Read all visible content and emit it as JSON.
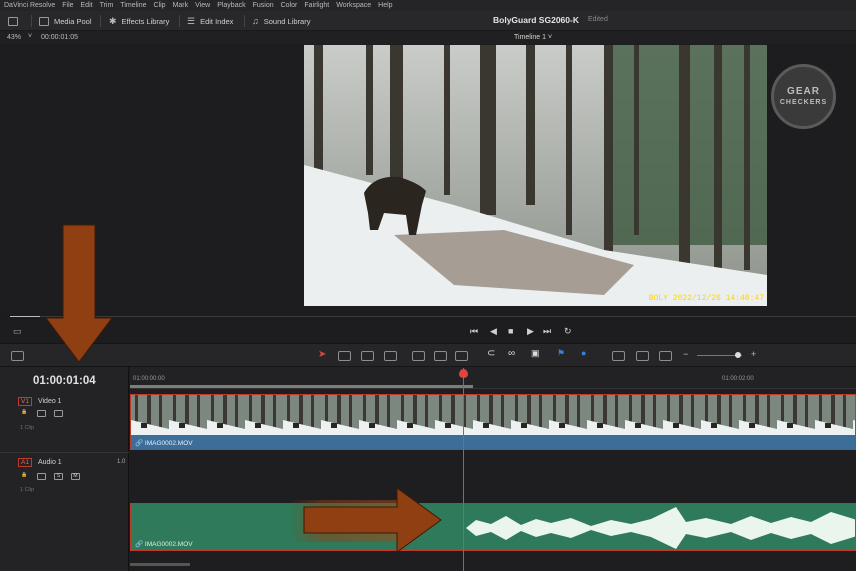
{
  "menu": [
    "DaVinci Resolve",
    "File",
    "Edit",
    "Trim",
    "Timeline",
    "Clip",
    "Mark",
    "View",
    "Playback",
    "Fusion",
    "Color",
    "Fairlight",
    "Workspace",
    "Help"
  ],
  "toolbar": {
    "media_pool": "Media Pool",
    "effects_library": "Effects Library",
    "edit_index": "Edit Index",
    "sound_library": "Sound Library",
    "project_title": "BolyGuard SG2060-K",
    "project_status": "Edited"
  },
  "viewer_bar": {
    "zoom": "43%",
    "timecode": "00:00:01:05",
    "timeline_name": "Timeline 1 ˅"
  },
  "viewer": {
    "frame_timestamp": "BOLY  2022/12/26  14:48:47"
  },
  "logo": {
    "line1": "GEAR",
    "line2": "CHECKERS"
  },
  "timeline": {
    "current_timecode": "01:00:01:04",
    "ruler_start": "01:00:00:00",
    "ruler_end": "01:00:02:00",
    "video_track": {
      "tag": "V1",
      "name": "Video 1",
      "clips_count": "1 Clip",
      "clip_name": "IMAG0002.MOV"
    },
    "audio_track": {
      "tag": "A1",
      "name": "Audio 1",
      "level": "1.0",
      "clips_count": "1 Clip",
      "clip_name": "IMAG0002.MOV",
      "solo": "S",
      "mute": "M"
    }
  },
  "colors": {
    "accent_red": "#e0443c",
    "video_clip_bar": "#3d6e9a",
    "audio_clip": "#2f7a5a",
    "annotation_arrow": "#8f3f12"
  }
}
